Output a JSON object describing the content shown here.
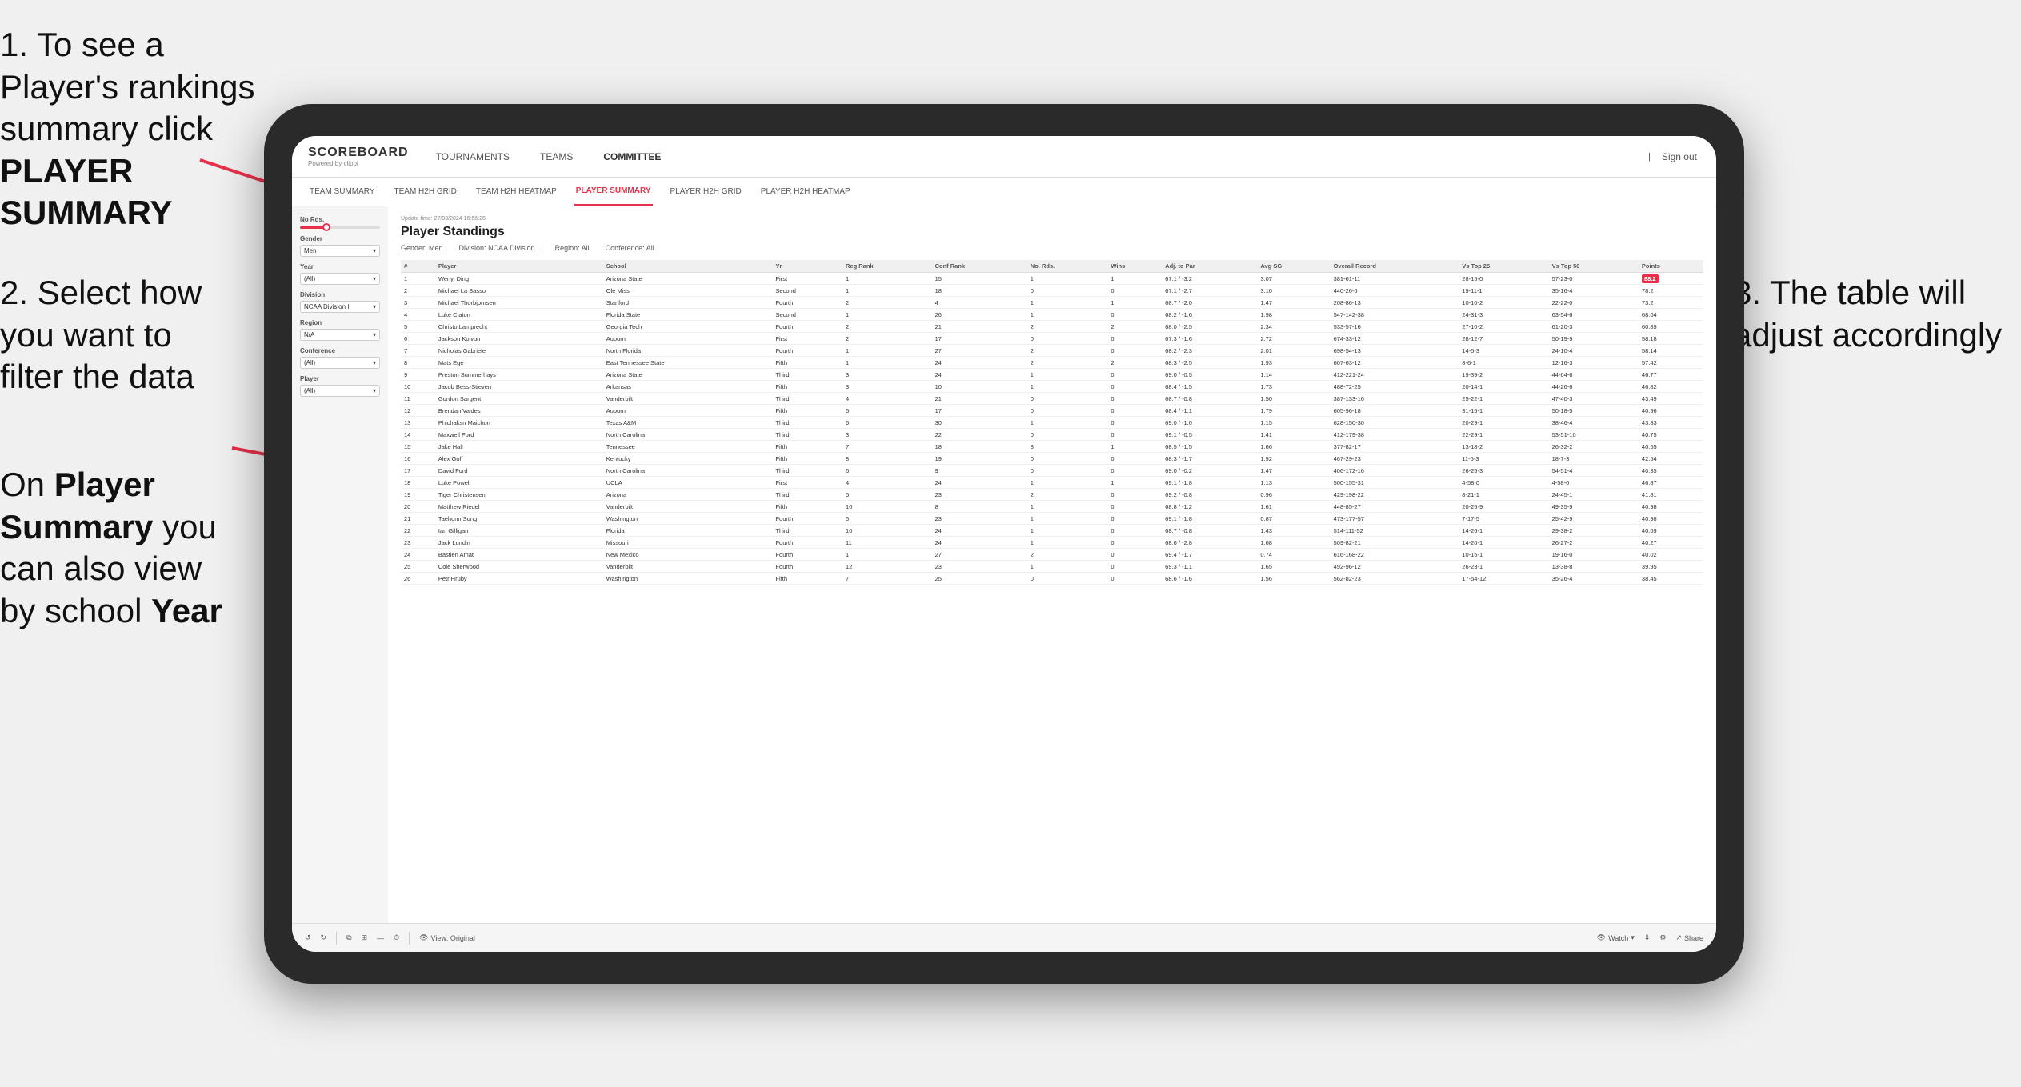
{
  "annotations": {
    "annotation1": "1. To see a Player's rankings summary click ",
    "annotation1_bold": "PLAYER SUMMARY",
    "annotation2_prefix": "2. Select how you want to filter the data",
    "annotation3_prefix": "On ",
    "annotation3_bold1": "Player Summary",
    "annotation3_text": " you can also view by school ",
    "annotation3_bold2": "Year",
    "annotation_right": "3. The table will adjust accordingly"
  },
  "app": {
    "logo": "SCOREBOARD",
    "logo_sub": "Powered by clippi",
    "sign_out": "Sign out",
    "nav_items": [
      "TOURNAMENTS",
      "TEAMS",
      "COMMITTEE"
    ],
    "sub_nav_items": [
      "TEAM SUMMARY",
      "TEAM H2H GRID",
      "TEAM H2H HEATMAP",
      "PLAYER SUMMARY",
      "PLAYER H2H GRID",
      "PLAYER H2H HEATMAP"
    ]
  },
  "sidebar": {
    "no_rds_label": "No Rds.",
    "gender_label": "Gender",
    "gender_value": "Men",
    "year_label": "Year",
    "year_value": "(All)",
    "division_label": "Division",
    "division_value": "NCAA Division I",
    "region_label": "Region",
    "region_value": "N/A",
    "conference_label": "Conference",
    "conference_value": "(All)",
    "player_label": "Player",
    "player_value": "(All)"
  },
  "table": {
    "update_time": "Update time: 27/03/2024 16:56:26",
    "title": "Player Standings",
    "filters": {
      "gender": "Men",
      "division": "NCAA Division I",
      "region": "All",
      "conference": "All"
    },
    "columns": [
      "#",
      "Player",
      "School",
      "Yr",
      "Reg Rank",
      "Conf Rank",
      "No. Rds.",
      "Wins",
      "Adj. to Par",
      "Avg SG",
      "Overall Record",
      "Vs Top 25",
      "Vs Top 50",
      "Points"
    ],
    "rows": [
      {
        "rank": "1",
        "player": "Wenyi Ding",
        "school": "Arizona State",
        "yr": "First",
        "reg_rank": "1",
        "conf_rank": "15",
        "no_rds": "1",
        "wins": "1",
        "adj": "67.1",
        "adj2": "-3.2",
        "avg_sg": "3.07",
        "record": "381-61-11",
        "vt25": "28-15-0",
        "vt50": "57-23-0",
        "points": "88.2",
        "highlight": true
      },
      {
        "rank": "2",
        "player": "Michael La Sasso",
        "school": "Ole Miss",
        "yr": "Second",
        "reg_rank": "1",
        "conf_rank": "18",
        "no_rds": "0",
        "wins": "0",
        "adj": "67.1",
        "adj2": "-2.7",
        "avg_sg": "3.10",
        "record": "440-26-6",
        "vt25": "19-11-1",
        "vt50": "35-16-4",
        "points": "78.2"
      },
      {
        "rank": "3",
        "player": "Michael Thorbjornsen",
        "school": "Stanford",
        "yr": "Fourth",
        "reg_rank": "2",
        "conf_rank": "4",
        "no_rds": "1",
        "wins": "1",
        "adj": "68.7",
        "adj2": "-2.0",
        "avg_sg": "1.47",
        "record": "208-86-13",
        "vt25": "10-10-2",
        "vt50": "22-22-0",
        "points": "73.2"
      },
      {
        "rank": "4",
        "player": "Luke Claton",
        "school": "Florida State",
        "yr": "Second",
        "reg_rank": "1",
        "conf_rank": "26",
        "no_rds": "1",
        "wins": "0",
        "adj": "68.2",
        "adj2": "-1.6",
        "avg_sg": "1.98",
        "record": "547-142-38",
        "vt25": "24-31-3",
        "vt50": "63-54-6",
        "points": "68.04"
      },
      {
        "rank": "5",
        "player": "Christo Lamprecht",
        "school": "Georgia Tech",
        "yr": "Fourth",
        "reg_rank": "2",
        "conf_rank": "21",
        "no_rds": "2",
        "wins": "2",
        "adj": "68.0",
        "adj2": "-2.5",
        "avg_sg": "2.34",
        "record": "533-57-16",
        "vt25": "27-10-2",
        "vt50": "61-20-3",
        "points": "60.89"
      },
      {
        "rank": "6",
        "player": "Jackson Koivun",
        "school": "Auburn",
        "yr": "First",
        "reg_rank": "2",
        "conf_rank": "17",
        "no_rds": "0",
        "wins": "0",
        "adj": "67.3",
        "adj2": "-1.6",
        "avg_sg": "2.72",
        "record": "674-33-12",
        "vt25": "28-12-7",
        "vt50": "50-19-9",
        "points": "58.18"
      },
      {
        "rank": "7",
        "player": "Nicholas Gabriele",
        "school": "North Florida",
        "yr": "Fourth",
        "reg_rank": "1",
        "conf_rank": "27",
        "no_rds": "2",
        "wins": "0",
        "adj": "68.2",
        "adj2": "-2.3",
        "avg_sg": "2.01",
        "record": "698-54-13",
        "vt25": "14-5-3",
        "vt50": "24-10-4",
        "points": "58.14"
      },
      {
        "rank": "8",
        "player": "Mats Ege",
        "school": "East Tennessee State",
        "yr": "Fifth",
        "reg_rank": "1",
        "conf_rank": "24",
        "no_rds": "2",
        "wins": "2",
        "adj": "68.3",
        "adj2": "-2.5",
        "avg_sg": "1.93",
        "record": "607-63-12",
        "vt25": "8-6-1",
        "vt50": "12-16-3",
        "points": "57.42"
      },
      {
        "rank": "9",
        "player": "Preston Summerhays",
        "school": "Arizona State",
        "yr": "Third",
        "reg_rank": "3",
        "conf_rank": "24",
        "no_rds": "1",
        "wins": "0",
        "adj": "69.0",
        "adj2": "-0.5",
        "avg_sg": "1.14",
        "record": "412-221-24",
        "vt25": "19-39-2",
        "vt50": "44-64-6",
        "points": "46.77"
      },
      {
        "rank": "10",
        "player": "Jacob Bess-Stieven",
        "school": "Arkansas",
        "yr": "Fifth",
        "reg_rank": "3",
        "conf_rank": "10",
        "no_rds": "1",
        "wins": "0",
        "adj": "68.4",
        "adj2": "-1.5",
        "avg_sg": "1.73",
        "record": "488-72-25",
        "vt25": "20-14-1",
        "vt50": "44-26-6",
        "points": "46.82"
      },
      {
        "rank": "11",
        "player": "Gordon Sargent",
        "school": "Vanderbilt",
        "yr": "Third",
        "reg_rank": "4",
        "conf_rank": "21",
        "no_rds": "0",
        "wins": "0",
        "adj": "68.7",
        "adj2": "-0.8",
        "avg_sg": "1.50",
        "record": "387-133-16",
        "vt25": "25-22-1",
        "vt50": "47-40-3",
        "points": "43.49"
      },
      {
        "rank": "12",
        "player": "Brendan Valdes",
        "school": "Auburn",
        "yr": "Fifth",
        "reg_rank": "5",
        "conf_rank": "17",
        "no_rds": "0",
        "wins": "0",
        "adj": "68.4",
        "adj2": "-1.1",
        "avg_sg": "1.79",
        "record": "605-96-18",
        "vt25": "31-15-1",
        "vt50": "50-18-5",
        "points": "40.96"
      },
      {
        "rank": "13",
        "player": "Phichaksn Maichon",
        "school": "Texas A&M",
        "yr": "Third",
        "reg_rank": "6",
        "conf_rank": "30",
        "no_rds": "1",
        "wins": "0",
        "adj": "69.0",
        "adj2": "-1.0",
        "avg_sg": "1.15",
        "record": "628-150-30",
        "vt25": "20-29-1",
        "vt50": "38-46-4",
        "points": "43.83"
      },
      {
        "rank": "14",
        "player": "Maxwell Ford",
        "school": "North Carolina",
        "yr": "Third",
        "reg_rank": "3",
        "conf_rank": "22",
        "no_rds": "0",
        "wins": "0",
        "adj": "69.1",
        "adj2": "-0.5",
        "avg_sg": "1.41",
        "record": "412-179-38",
        "vt25": "22-29-1",
        "vt50": "53-51-10",
        "points": "40.75"
      },
      {
        "rank": "15",
        "player": "Jake Hall",
        "school": "Tennessee",
        "yr": "Fifth",
        "reg_rank": "7",
        "conf_rank": "18",
        "no_rds": "8",
        "wins": "1",
        "adj": "68.5",
        "adj2": "-1.5",
        "avg_sg": "1.66",
        "record": "377-82-17",
        "vt25": "13-18-2",
        "vt50": "26-32-2",
        "points": "40.55"
      },
      {
        "rank": "16",
        "player": "Alex Goff",
        "school": "Kentucky",
        "yr": "Fifth",
        "reg_rank": "8",
        "conf_rank": "19",
        "no_rds": "0",
        "wins": "0",
        "adj": "68.3",
        "adj2": "-1.7",
        "avg_sg": "1.92",
        "record": "467-29-23",
        "vt25": "11-5-3",
        "vt50": "18-7-3",
        "points": "42.54"
      },
      {
        "rank": "17",
        "player": "David Ford",
        "school": "North Carolina",
        "yr": "Third",
        "reg_rank": "6",
        "conf_rank": "9",
        "no_rds": "0",
        "wins": "0",
        "adj": "69.0",
        "adj2": "-0.2",
        "avg_sg": "1.47",
        "record": "406-172-16",
        "vt25": "26-25-3",
        "vt50": "54-51-4",
        "points": "40.35"
      },
      {
        "rank": "18",
        "player": "Luke Powell",
        "school": "UCLA",
        "yr": "First",
        "reg_rank": "4",
        "conf_rank": "24",
        "no_rds": "1",
        "wins": "1",
        "adj": "69.1",
        "adj2": "-1.8",
        "avg_sg": "1.13",
        "record": "500-155-31",
        "vt25": "4-58-0",
        "vt50": "4-58-0",
        "points": "46.87"
      },
      {
        "rank": "19",
        "player": "Tiger Christensen",
        "school": "Arizona",
        "yr": "Third",
        "reg_rank": "5",
        "conf_rank": "23",
        "no_rds": "2",
        "wins": "0",
        "adj": "69.2",
        "adj2": "-0.8",
        "avg_sg": "0.96",
        "record": "429-198-22",
        "vt25": "8-21-1",
        "vt50": "24-45-1",
        "points": "41.81"
      },
      {
        "rank": "20",
        "player": "Matthew Riedel",
        "school": "Vanderbilt",
        "yr": "Fifth",
        "reg_rank": "10",
        "conf_rank": "8",
        "no_rds": "1",
        "wins": "0",
        "adj": "68.8",
        "adj2": "-1.2",
        "avg_sg": "1.61",
        "record": "448-85-27",
        "vt25": "20-25-9",
        "vt50": "49-35-9",
        "points": "40.98"
      },
      {
        "rank": "21",
        "player": "Taehonn Song",
        "school": "Washington",
        "yr": "Fourth",
        "reg_rank": "5",
        "conf_rank": "23",
        "no_rds": "1",
        "wins": "0",
        "adj": "69.1",
        "adj2": "-1.8",
        "avg_sg": "0.87",
        "record": "473-177-57",
        "vt25": "7-17-5",
        "vt50": "25-42-9",
        "points": "40.98"
      },
      {
        "rank": "22",
        "player": "Ian Gilligan",
        "school": "Florida",
        "yr": "Third",
        "reg_rank": "10",
        "conf_rank": "24",
        "no_rds": "1",
        "wins": "0",
        "adj": "68.7",
        "adj2": "-0.8",
        "avg_sg": "1.43",
        "record": "514-111-52",
        "vt25": "14-26-1",
        "vt50": "29-38-2",
        "points": "40.69"
      },
      {
        "rank": "23",
        "player": "Jack Lundin",
        "school": "Missouri",
        "yr": "Fourth",
        "reg_rank": "11",
        "conf_rank": "24",
        "no_rds": "1",
        "wins": "0",
        "adj": "68.6",
        "adj2": "-2.8",
        "avg_sg": "1.68",
        "record": "509-82-21",
        "vt25": "14-20-1",
        "vt50": "26-27-2",
        "points": "40.27"
      },
      {
        "rank": "24",
        "player": "Bastien Amat",
        "school": "New Mexico",
        "yr": "Fourth",
        "reg_rank": "1",
        "conf_rank": "27",
        "no_rds": "2",
        "wins": "0",
        "adj": "69.4",
        "adj2": "-1.7",
        "avg_sg": "0.74",
        "record": "616-168-22",
        "vt25": "10-15-1",
        "vt50": "19-16-0",
        "points": "40.02"
      },
      {
        "rank": "25",
        "player": "Cole Sherwood",
        "school": "Vanderbilt",
        "yr": "Fourth",
        "reg_rank": "12",
        "conf_rank": "23",
        "no_rds": "1",
        "wins": "0",
        "adj": "69.3",
        "adj2": "-1.1",
        "avg_sg": "1.65",
        "record": "492-96-12",
        "vt25": "26-23-1",
        "vt50": "13-38-8",
        "points": "39.95"
      },
      {
        "rank": "26",
        "player": "Petr Hruby",
        "school": "Washington",
        "yr": "Fifth",
        "reg_rank": "7",
        "conf_rank": "25",
        "no_rds": "0",
        "wins": "0",
        "adj": "68.6",
        "adj2": "-1.6",
        "avg_sg": "1.56",
        "record": "562-82-23",
        "vt25": "17-54-12",
        "vt50": "35-26-4",
        "points": "38.45"
      }
    ]
  },
  "toolbar": {
    "view_label": "View: Original",
    "watch_label": "Watch",
    "share_label": "Share"
  }
}
